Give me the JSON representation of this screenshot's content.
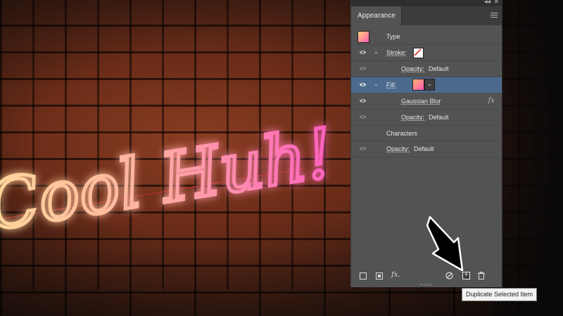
{
  "canvas": {
    "neon_text": "Cool Huh!",
    "colors": {
      "neon_warm": "#ffcf8a",
      "neon_pink": "#ff6ec0",
      "brick": "#7a3a22"
    }
  },
  "panel": {
    "tab_label": "Appearance",
    "rows": {
      "type": {
        "label": "Type"
      },
      "stroke": {
        "label": "Stroke:"
      },
      "stroke_opacity": {
        "label": "Opacity:",
        "value": "Default"
      },
      "fill": {
        "label": "Fill:"
      },
      "gaussian_blur": {
        "label": "Gaussian Blur",
        "fx": "fx"
      },
      "fill_opacity": {
        "label": "Opacity:",
        "value": "Default"
      },
      "characters": {
        "label": "Characters"
      },
      "char_opacity": {
        "label": "Opacity:",
        "value": "Default"
      }
    },
    "bottom_fx": "fx.",
    "dup_glyph": "+",
    "chevron": "⌄",
    "menu_icons": {
      "collapse": "◂◂",
      "close": "✕"
    }
  },
  "tooltip": {
    "text": "Duplicate Selected Item"
  }
}
